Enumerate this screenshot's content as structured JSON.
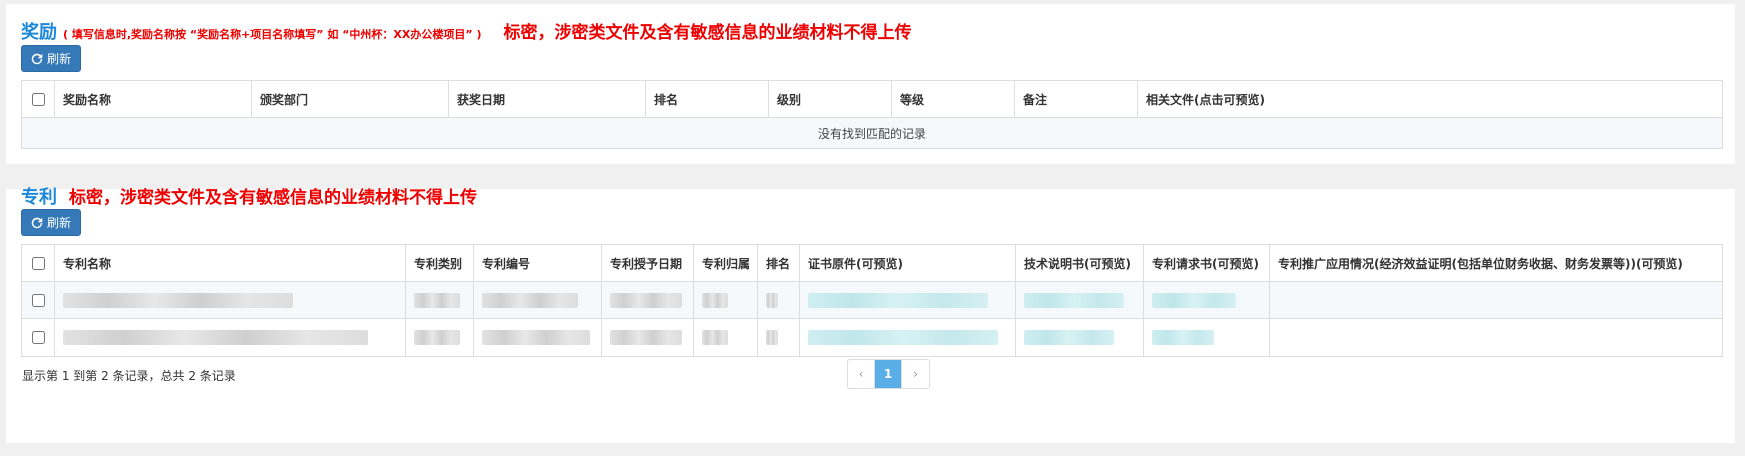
{
  "awards": {
    "title": "奖励",
    "hint": "( 填写信息时,奖励名称按 “奖励名称+项目名称填写” 如 “中州杯：XX办公楼项目” )",
    "warning": "标密，涉密类文件及含有敏感信息的业绩材料不得上传",
    "refresh_label": "刷新",
    "columns": [
      "奖励名称",
      "颁奖部门",
      "获奖日期",
      "排名",
      "级别",
      "等级",
      "备注",
      "相关文件(点击可预览)"
    ],
    "empty_text": "没有找到匹配的记录"
  },
  "patents": {
    "title": "专利",
    "warning": "标密，涉密类文件及含有敏感信息的业绩材料不得上传",
    "refresh_label": "刷新",
    "columns": [
      "专利名称",
      "专利类别",
      "专利编号",
      "专利授予日期",
      "专利归属",
      "排名",
      "证书原件(可预览)",
      "技术说明书(可预览)",
      "专利请求书(可预览)",
      "专利推广应用情况(经济效益证明(包括单位财务收据、财务发票等))(可预览)"
    ],
    "pagination_info": "显示第 1 到第 2 条记录，总共 2 条记录",
    "pager": {
      "prev": "‹",
      "current": "1",
      "next": "›"
    }
  },
  "colors": {
    "accent": "#1e88d8",
    "warning": "#ee0000",
    "button": "#3679b9",
    "pager_active": "#5aaee8"
  }
}
